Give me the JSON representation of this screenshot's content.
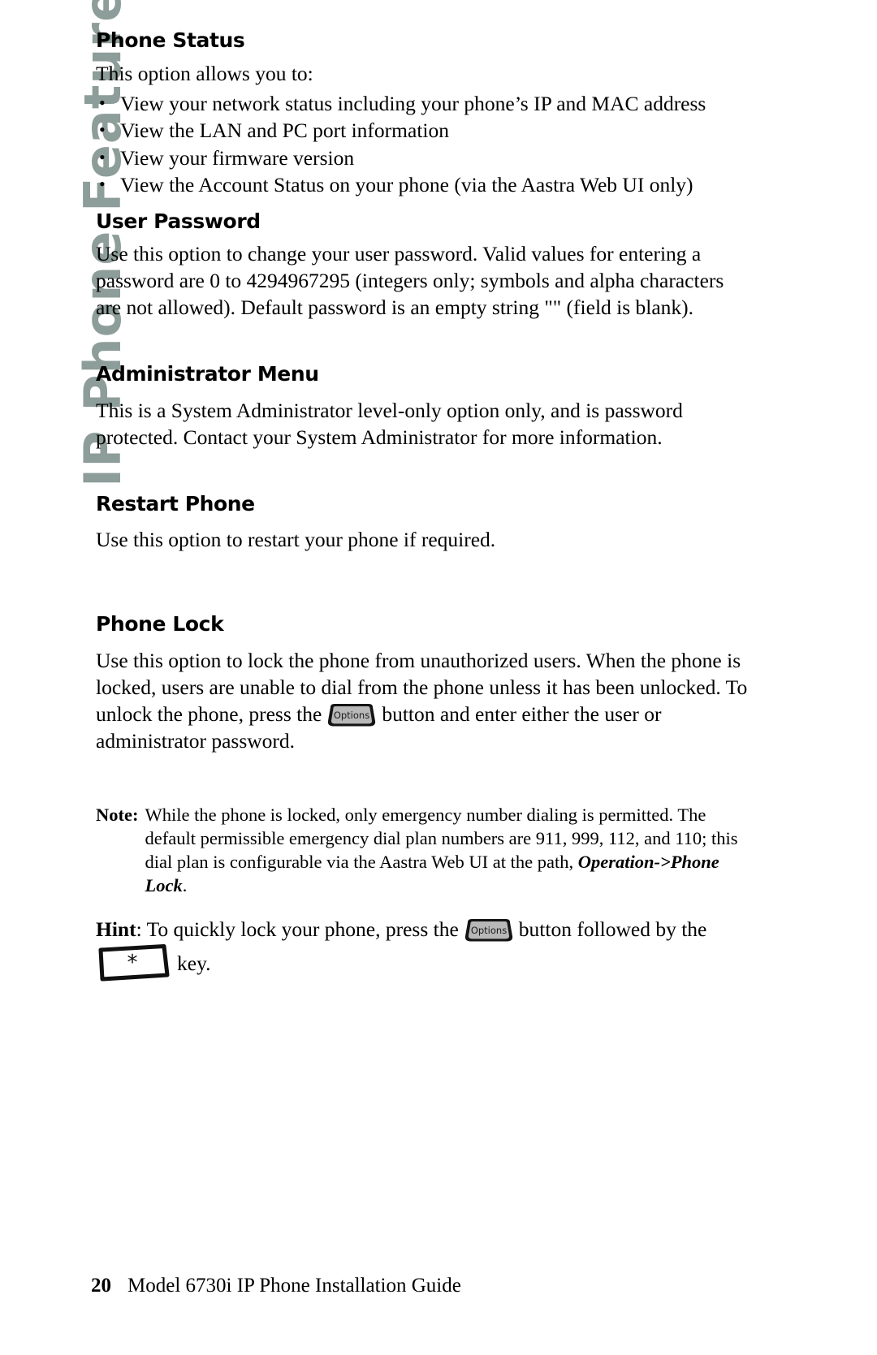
{
  "side_tab": {
    "label": "IP Phone Features",
    "color": "#8d9d99"
  },
  "sections": [
    {
      "heading": "Phone Status",
      "intro": "This option allows you to:",
      "bullets": [
        "View your network status including your phone’s IP and MAC address",
        "View the LAN and PC port information",
        "View your firmware version",
        "View the Account Status on your phone (via the Aastra Web UI only)"
      ]
    },
    {
      "heading": "User Password",
      "paragraph": "Use this option to change your user password. Valid values for entering a password are 0 to 4294967295 (integers only; symbols and alpha characters are not allowed). Default password is an empty string \"\" (field is blank)."
    },
    {
      "heading": "Administrator Menu",
      "paragraph": "This is a System Administrator level-only option only, and is password protected. Contact your System Administrator for more information."
    },
    {
      "heading": "Restart Phone",
      "paragraph": "Use this option to restart your phone if required."
    },
    {
      "heading": "Phone Lock",
      "para_part1": "Use this option to lock the phone from unauthorized users.  When the phone is locked, users are unable to dial from the phone unless it has been unlocked.  To unlock the phone, press the",
      "para_part2": "button and enter either the user or administrator password."
    }
  ],
  "options_key": {
    "label": "Options"
  },
  "star_key": {
    "label": "✱",
    "glyph": "*"
  },
  "note": {
    "label": "Note:",
    "line1": "While the phone is locked, only emergency number dialing is permitted.  The",
    "line2": "default permissible emergency dial plan numbers are 911, 999, 112, and 110; this",
    "line3": "dial plan is configurable via the Aastra Web UI at the path,",
    "path": "Operation->Phone Lock",
    "path_end": "."
  },
  "hint": {
    "label": "Hint",
    "part1": ": To quickly lock your phone, press the",
    "part2": "button followed by the",
    "part3": "key."
  },
  "footer": {
    "page_number": "20",
    "title": "Model 6730i IP Phone Installation Guide"
  }
}
